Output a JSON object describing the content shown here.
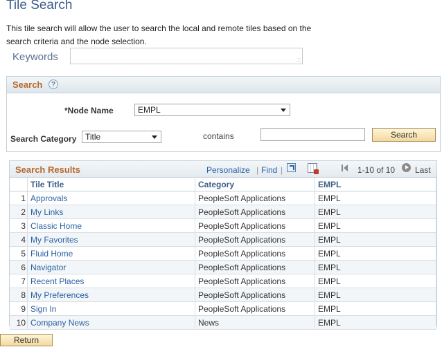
{
  "page": {
    "title": "Tile Search",
    "description": "This tile search will allow the user to search the local and remote tiles based on the search criteria and the node selection."
  },
  "keywords": {
    "label": "Keywords",
    "value": ""
  },
  "search": {
    "header": "Search",
    "help": "?",
    "node_label": "*Node Name",
    "node_value": "EMPL",
    "category_label": "Search Category",
    "category_value": "Title",
    "contains_label": "contains",
    "contains_value": "",
    "button_label": "Search"
  },
  "results": {
    "title": "Search Results",
    "personalize": "Personalize",
    "separator": "|",
    "find": "Find",
    "range": "1-10 of 10",
    "last": "Last",
    "columns": [
      "Tile Title",
      "Category",
      "EMPL"
    ],
    "rows": [
      {
        "num": "1",
        "title": "Approvals",
        "category": "PeopleSoft Applications",
        "node": "EMPL"
      },
      {
        "num": "2",
        "title": "My Links",
        "category": "PeopleSoft Applications",
        "node": "EMPL"
      },
      {
        "num": "3",
        "title": "Classic Home",
        "category": "PeopleSoft Applications",
        "node": "EMPL"
      },
      {
        "num": "4",
        "title": "My Favorites",
        "category": "PeopleSoft Applications",
        "node": "EMPL"
      },
      {
        "num": "5",
        "title": "Fluid Home",
        "category": "PeopleSoft Applications",
        "node": "EMPL"
      },
      {
        "num": "6",
        "title": "Navigator",
        "category": "PeopleSoft Applications",
        "node": "EMPL"
      },
      {
        "num": "7",
        "title": "Recent Places",
        "category": "PeopleSoft Applications",
        "node": "EMPL"
      },
      {
        "num": "8",
        "title": "My Preferences",
        "category": "PeopleSoft Applications",
        "node": "EMPL"
      },
      {
        "num": "9",
        "title": "Sign In",
        "category": "PeopleSoft Applications",
        "node": "EMPL"
      },
      {
        "num": "10",
        "title": "Company News",
        "category": "News",
        "node": "EMPL"
      }
    ]
  },
  "footer": {
    "return_label": "Return"
  },
  "colors": {
    "title": "#3d5a8a",
    "header_accent": "#b8682a",
    "link": "#2a61a6",
    "button": "#f3d99f"
  },
  "icons": [
    "help-icon",
    "grip-icon",
    "chevron-down-icon",
    "zoom-icon",
    "download-icon",
    "first-page-icon",
    "next-page-icon"
  ]
}
